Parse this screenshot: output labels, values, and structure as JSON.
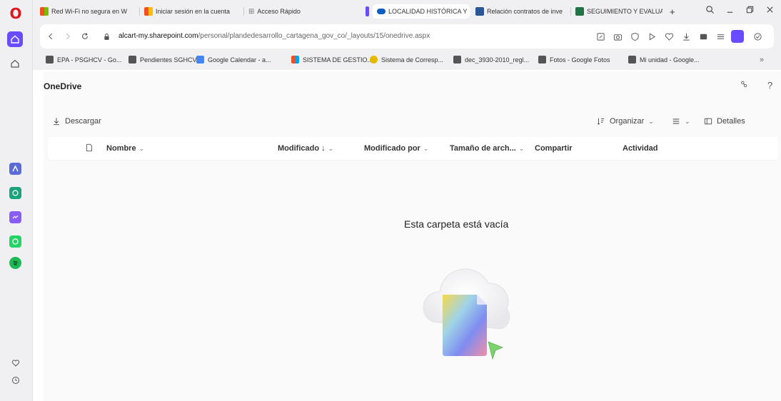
{
  "rail": {
    "logo": "O"
  },
  "tabs": [
    {
      "label": "Red Wi-Fi no segura en W",
      "icon": "windows-icon"
    },
    {
      "label": "Iniciar sesión en la cuenta",
      "icon": "windows-icon"
    },
    {
      "label": "Acceso Rápido",
      "icon": "speed-dial-icon"
    },
    {
      "label": "LOCALIDAD HISTÓRICA Y",
      "icon": "onedrive-icon"
    },
    {
      "label": "Relación contratos de inve",
      "icon": "word-icon"
    },
    {
      "label": "SEGUIMIENTO Y EVALUAC",
      "icon": "excel-icon"
    }
  ],
  "new_tab": "+",
  "address": {
    "domain": "alcart-my.sharepoint.com",
    "path": "/personal/plandedesarrollo_cartagena_gov_co/_layouts/15/onedrive.aspx"
  },
  "bookmarks": [
    {
      "label": "EPA - PSGHCV - Go...",
      "icon": "doc-icon"
    },
    {
      "label": "Pendientes SGHCV",
      "icon": "doc-icon"
    },
    {
      "label": "Google Calendar - a...",
      "icon": "calendar-icon"
    },
    {
      "label": "SISTEMA DE GESTIO...",
      "icon": "windows-icon"
    },
    {
      "label": "Sistema de Corresp...",
      "icon": "globe-icon"
    },
    {
      "label": "dec_3930-2010_regl...",
      "icon": "doc-icon"
    },
    {
      "label": "Fotos - Google Fotos",
      "icon": "doc-icon"
    },
    {
      "label": "Mi unidad - Google...",
      "icon": "doc-icon"
    }
  ],
  "bookmarks_more": "»",
  "onedrive": {
    "title": "OneDrive",
    "download": "Descargar",
    "sort": "Organizar",
    "details": "Detalles",
    "columns": {
      "name": "Nombre",
      "modified": "Modificado ↓",
      "modified_by": "Modificado por",
      "size": "Tamaño de arch...",
      "sharing": "Compartir",
      "activity": "Actividad"
    },
    "empty_message": "Esta carpeta está vacía"
  },
  "colors": {
    "opera_red": "#e0161e",
    "accent": "#6a4cff",
    "chrome_bg": "#f0f0f3"
  }
}
